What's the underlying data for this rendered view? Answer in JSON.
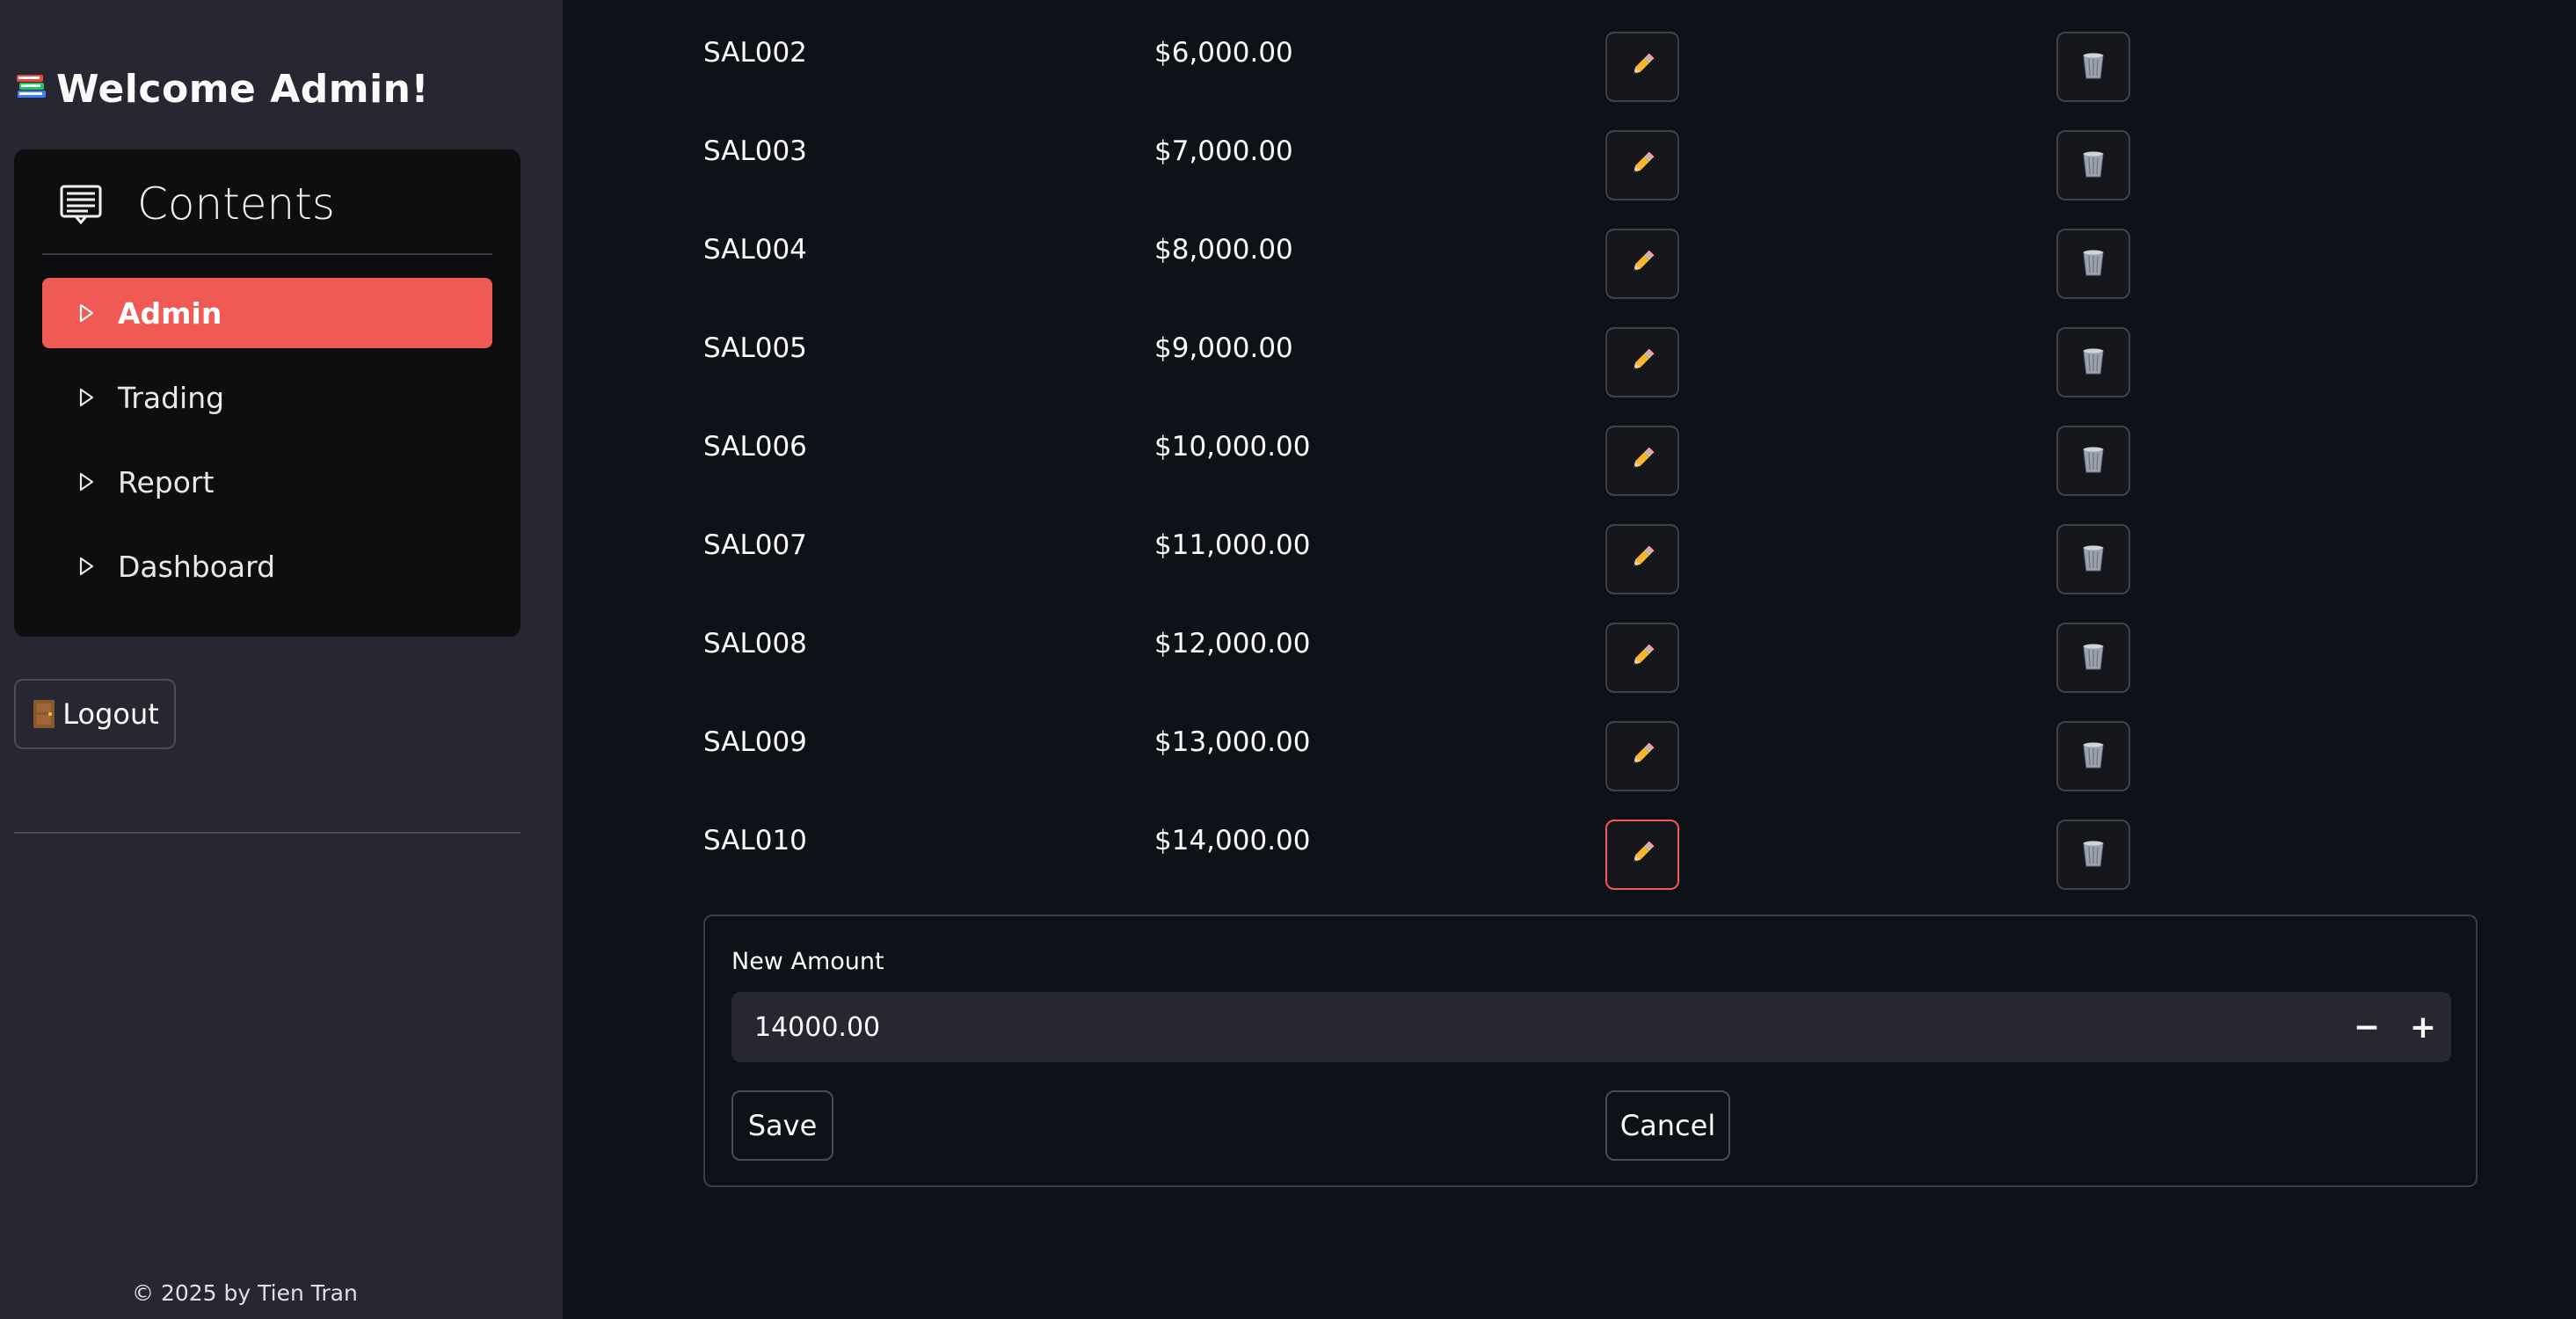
{
  "sidebar": {
    "welcome_icon": "books-emoji",
    "welcome_text": "Welcome Admin!",
    "menu_title": "Contents",
    "items": [
      {
        "label": "Admin",
        "active": true
      },
      {
        "label": "Trading",
        "active": false
      },
      {
        "label": "Report",
        "active": false
      },
      {
        "label": "Dashboard",
        "active": false
      }
    ],
    "logout_label": "Logout",
    "footer": "© 2025 by Tien Tran"
  },
  "table": {
    "rows": [
      {
        "id": "SAL002",
        "amount": "$6,000.00"
      },
      {
        "id": "SAL003",
        "amount": "$7,000.00"
      },
      {
        "id": "SAL004",
        "amount": "$8,000.00"
      },
      {
        "id": "SAL005",
        "amount": "$9,000.00"
      },
      {
        "id": "SAL006",
        "amount": "$10,000.00"
      },
      {
        "id": "SAL007",
        "amount": "$11,000.00"
      },
      {
        "id": "SAL008",
        "amount": "$12,000.00"
      },
      {
        "id": "SAL009",
        "amount": "$13,000.00"
      },
      {
        "id": "SAL010",
        "amount": "$14,000.00"
      }
    ],
    "focused_row_index": 8
  },
  "edit_form": {
    "label": "New Amount",
    "value": "14000.00",
    "decrement": "−",
    "increment": "+",
    "save_label": "Save",
    "cancel_label": "Cancel"
  },
  "colors": {
    "accent": "#ef5b54",
    "sidebar_bg": "#262730",
    "main_bg": "#0e1117"
  }
}
